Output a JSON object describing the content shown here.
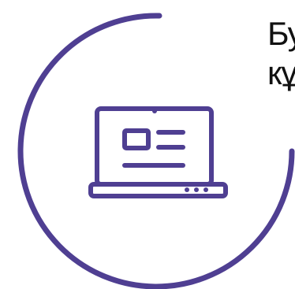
{
  "card": {
    "icon": "laptop-icon",
    "headline_line_1": "Бу",
    "headline_line_2": "кұ"
  },
  "colors": {
    "accent": "#4f3f92",
    "text": "#111111",
    "background": "#ffffff"
  }
}
